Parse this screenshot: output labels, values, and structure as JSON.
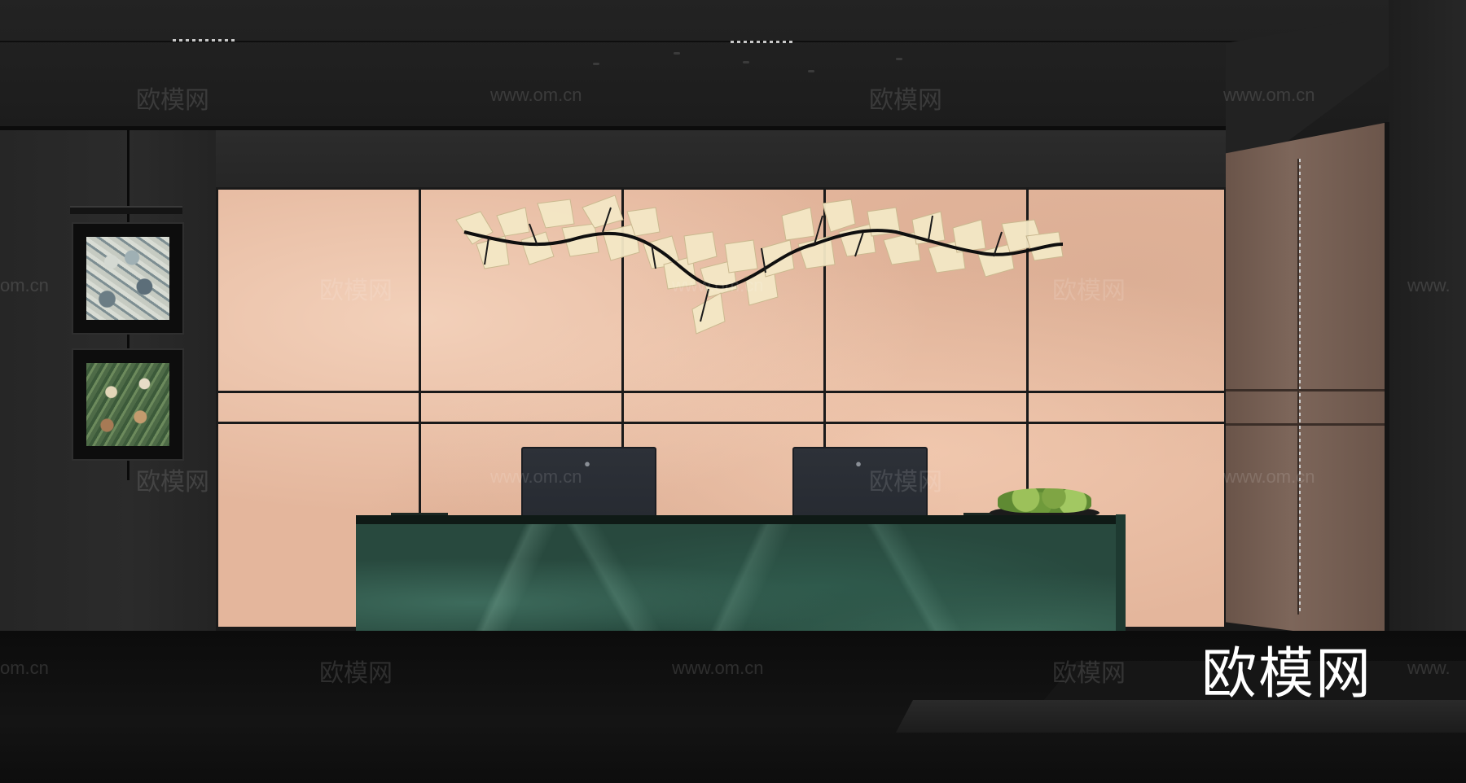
{
  "scene": {
    "watermarks": {
      "zh": "欧模网",
      "url": "www.om.cn",
      "url_partial": "om.cn",
      "url_left_partial": "www."
    },
    "brand_logo": "欧模网"
  },
  "colors": {
    "onyx_wall": "#e4b69c",
    "marble_desk": "#28493e",
    "side_wall_wood": "#7d665a",
    "monitor": "#2d3138",
    "plant": "#7fa544"
  },
  "icons": [
    "apple-logo-icon",
    "apple-logo-icon"
  ]
}
